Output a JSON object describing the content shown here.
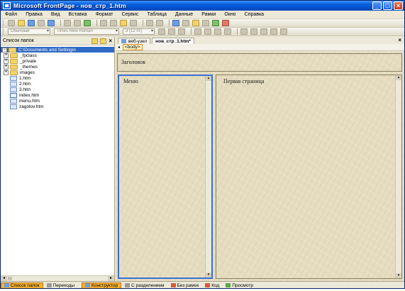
{
  "window": {
    "title": "Microsoft FrontPage - нов_стр_1.htm",
    "controls": [
      "_",
      "□",
      "×"
    ]
  },
  "menu": [
    "Файл",
    "Правка",
    "Вид",
    "Вставка",
    "Формат",
    "Сервис",
    "Таблица",
    "Данные",
    "Рамки",
    "Окно",
    "Справка"
  ],
  "toolbar2": {
    "style_combo": "Обычный",
    "font_combo": "Times New Roman",
    "size_combo": "3 (12 пт)"
  },
  "folder_panel": {
    "title": "Список папок",
    "close": "×",
    "root": "C:\\Documents and Settings\\",
    "items": [
      {
        "name": "_fpclass",
        "type": "folder",
        "expander": "+"
      },
      {
        "name": "_private",
        "type": "folder",
        "expander": "+"
      },
      {
        "name": "_themes",
        "type": "folder",
        "expander": "+"
      },
      {
        "name": "images",
        "type": "folder",
        "expander": "+"
      },
      {
        "name": "1.htm",
        "type": "file"
      },
      {
        "name": "2.htm",
        "type": "file"
      },
      {
        "name": "3.htm",
        "type": "file"
      },
      {
        "name": "index.htm",
        "type": "home"
      },
      {
        "name": "menu.htm",
        "type": "file"
      },
      {
        "name": "zagolov.htm",
        "type": "file"
      }
    ]
  },
  "editor": {
    "tabs": [
      {
        "label": "веб-узел",
        "active": false
      },
      {
        "label": "нов_стр_1.htm*",
        "active": true
      }
    ],
    "close": "×",
    "quick_tag": "<body>",
    "frames": {
      "header": "Заголовок",
      "menu": "Меню",
      "main": "Первая страница"
    }
  },
  "bottom_tabs": {
    "left": [
      {
        "label": "Список папок",
        "active": true
      },
      {
        "label": "Переходы",
        "active": false
      }
    ],
    "views": [
      {
        "label": "Конструктор",
        "active": true
      },
      {
        "label": "С разделением",
        "active": false
      },
      {
        "label": "Без рамок",
        "active": false
      },
      {
        "label": "Код",
        "active": false
      },
      {
        "label": "Просмотр",
        "active": false
      }
    ]
  },
  "colors": {
    "title_bar": "#0a5fe0",
    "selected_tree": "#316ac5",
    "active_tab": "#f8b030",
    "frame_selected_border": "#3b6fd4",
    "parchment": "#e5dcc0"
  }
}
